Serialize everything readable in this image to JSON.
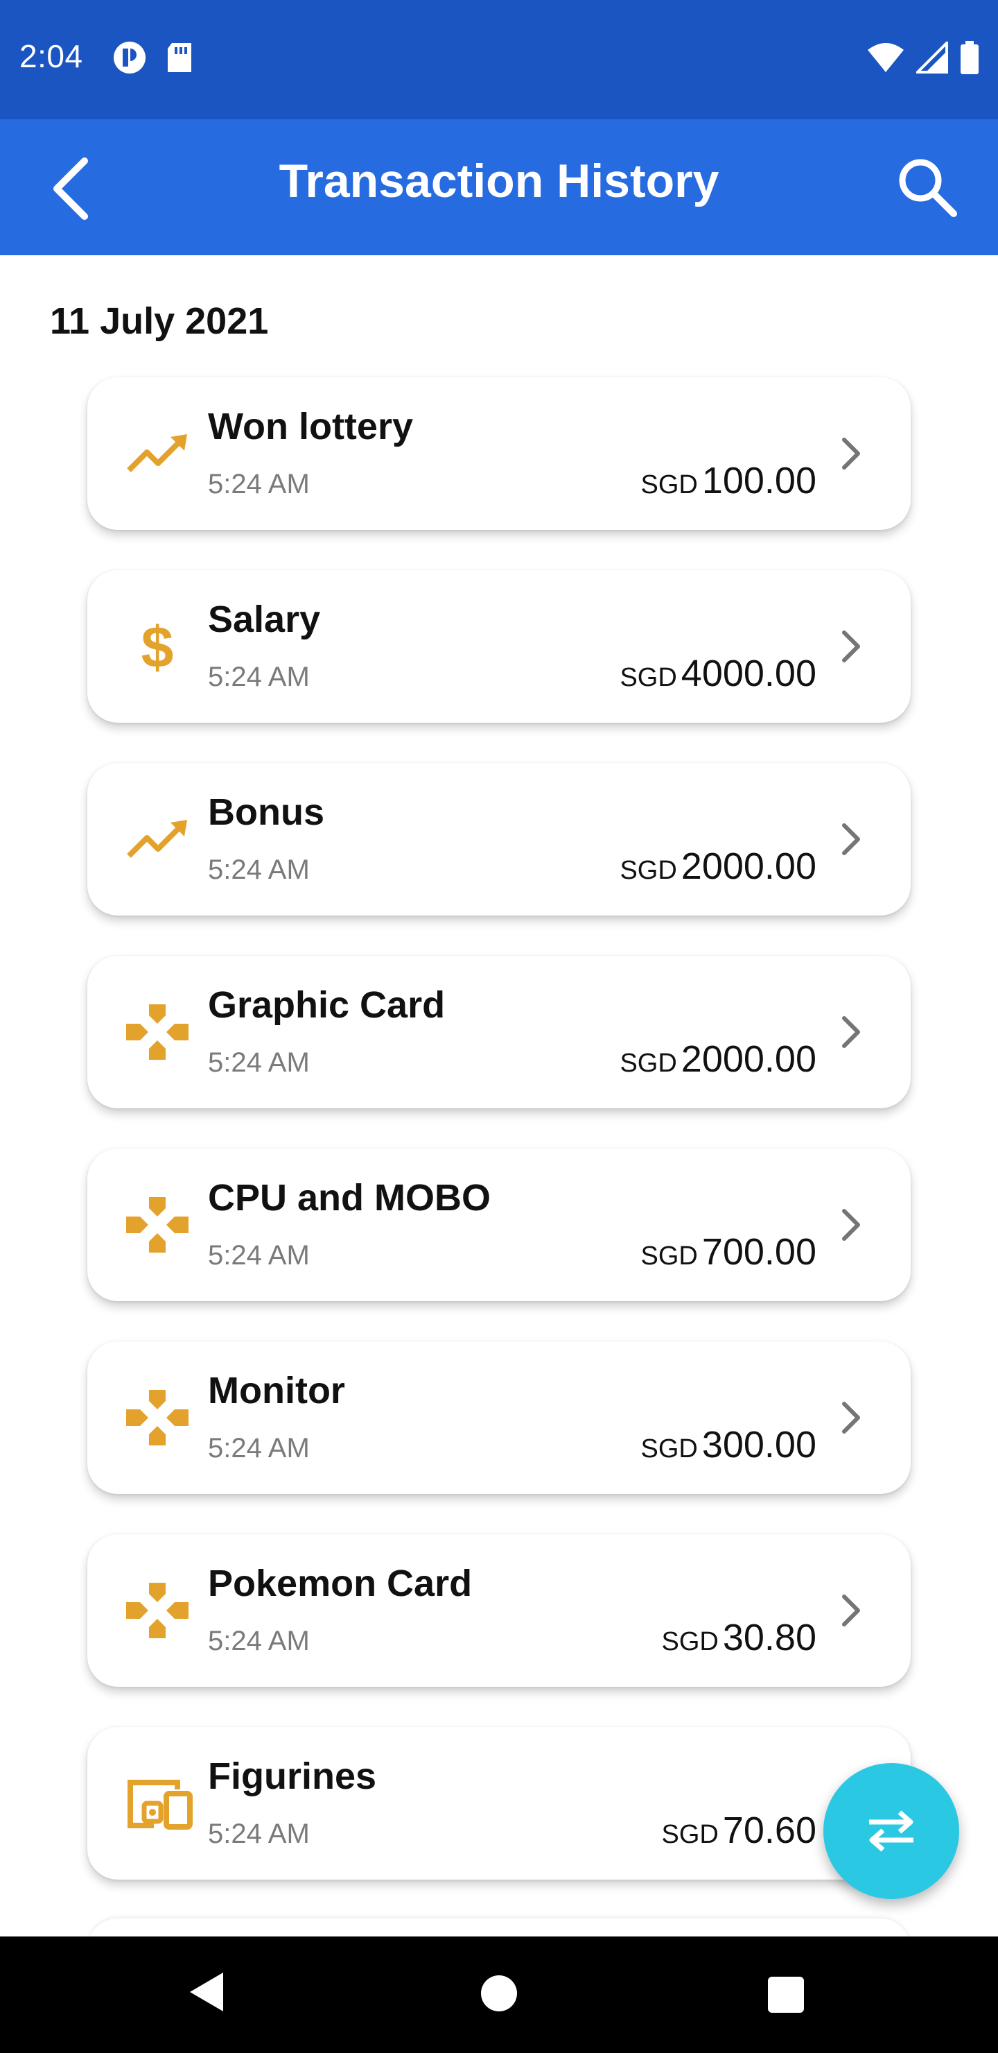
{
  "status_bar": {
    "time": "2:04",
    "left_icons": [
      "app-notification-icon",
      "sd-card-icon"
    ],
    "right_icons": [
      "wifi-icon",
      "cell-signal-icon",
      "battery-icon"
    ]
  },
  "app_bar": {
    "title": "Transaction History",
    "back_icon": "back-arrow-icon",
    "search_icon": "search-icon",
    "background": "#276be0"
  },
  "date_group": "11 July 2021",
  "transactions": [
    {
      "title": "Won lottery",
      "time": "5:24 AM",
      "currency": "SGD",
      "amount": "100.00",
      "icon": "trending-up-icon"
    },
    {
      "title": "Salary",
      "time": "5:24 AM",
      "currency": "SGD",
      "amount": "4000.00",
      "icon": "dollar-icon"
    },
    {
      "title": "Bonus",
      "time": "5:24 AM",
      "currency": "SGD",
      "amount": "2000.00",
      "icon": "trending-up-icon"
    },
    {
      "title": "Graphic Card",
      "time": "5:24 AM",
      "currency": "SGD",
      "amount": "2000.00",
      "icon": "gamepad-icon"
    },
    {
      "title": "CPU and MOBO",
      "time": "5:24 AM",
      "currency": "SGD",
      "amount": "700.00",
      "icon": "gamepad-icon"
    },
    {
      "title": "Monitor",
      "time": "5:24 AM",
      "currency": "SGD",
      "amount": "300.00",
      "icon": "gamepad-icon"
    },
    {
      "title": "Pokemon Card",
      "time": "5:24 AM",
      "currency": "SGD",
      "amount": "30.80",
      "icon": "gamepad-icon"
    },
    {
      "title": "Figurines",
      "time": "5:24 AM",
      "currency": "SGD",
      "amount": "70.60",
      "icon": "devices-icon"
    }
  ],
  "fab": {
    "icon": "swap-arrows-icon",
    "color": "#2bc8e4"
  },
  "colors": {
    "icon_accent": "#e3a22b",
    "status_bar": "#1a55c1"
  },
  "nav_bar": {
    "icons": [
      "nav-back-icon",
      "nav-home-icon",
      "nav-recents-icon"
    ]
  }
}
